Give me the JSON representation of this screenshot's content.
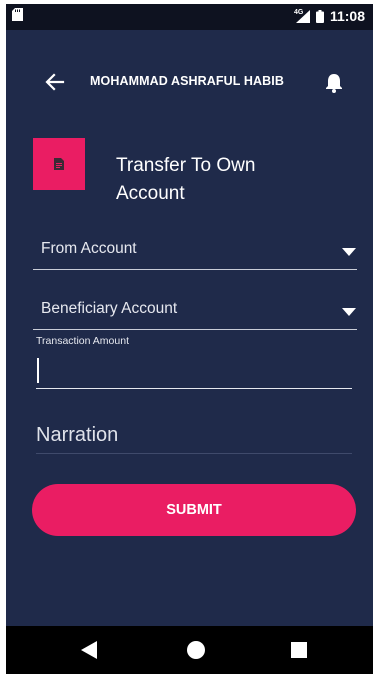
{
  "status_bar": {
    "network_type": "4G",
    "time": "11:08"
  },
  "app_bar": {
    "title": "MOHAMMAD ASHRAFUL HABIB",
    "back_icon": "arrow-left-icon",
    "notification_icon": "bell-icon"
  },
  "page": {
    "icon": "document-icon",
    "title": "Transfer To Own Account"
  },
  "form": {
    "from_account": {
      "label": "From Account",
      "icon": "caret-down-icon"
    },
    "beneficiary_account": {
      "label": "Beneficiary Account",
      "icon": "caret-down-icon"
    },
    "transaction_amount": {
      "label": "Transaction Amount",
      "value": ""
    },
    "narration": {
      "placeholder": "Narration",
      "value": ""
    },
    "submit_label": "SUBMIT"
  },
  "nav_bar": {
    "back_icon": "triangle-back-icon",
    "home_icon": "circle-home-icon",
    "recent_icon": "square-recent-icon"
  },
  "colors": {
    "background": "#1f2a4a",
    "accent": "#ea1d63",
    "status_bar": "#0e1220",
    "nav_bar": "#000000"
  }
}
